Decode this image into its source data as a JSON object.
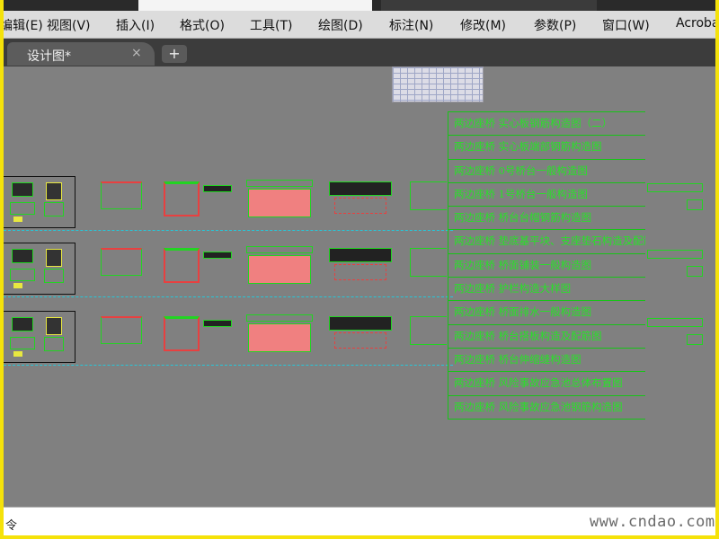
{
  "menu": {
    "items": [
      "编辑(E)",
      "视图(V)",
      "插入(I)",
      "格式(O)",
      "工具(T)",
      "绘图(D)",
      "标注(N)",
      "修改(M)",
      "参数(P)",
      "窗口(W)",
      "Acrobat"
    ]
  },
  "tabs": {
    "active": "设计图*",
    "close": "×",
    "new": "+"
  },
  "drawing": {
    "titles": [
      "两边座桥 实心板钢筋构造图（二）",
      "两边座桥 实心板端部钢筋构造图",
      "两边座桥 0号桥台一般构造图",
      "两边座桥 1号桥台一般构造图",
      "两边座桥 桥台台帽钢筋构造图",
      "两边座桥 垫底基平块、支座垫石构造及配筋图",
      "两边座桥 桥面铺装一般构造图",
      "两边座桥 护栏构造大样图",
      "两边座桥 桥面排水一般构造图",
      "两边座桥 桥台搭板构造及配筋图",
      "两边座桥 桥台伸缩缝构造图",
      "两边座桥 风险事故应急池总体布置图",
      "两边座桥 风险事故应急池钢筋构造图"
    ],
    "colors": {
      "background": "#808080",
      "line_green": "#17c417",
      "text_green": "#27e227",
      "fill_pink": "#f08080",
      "cyan": "#00e5ff"
    }
  },
  "command": {
    "prompt": "令"
  },
  "watermark": "www.cndao.com"
}
